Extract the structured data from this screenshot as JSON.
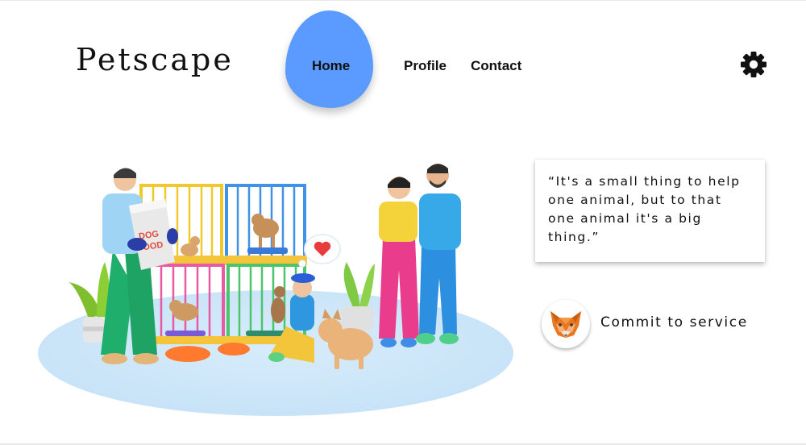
{
  "brand": {
    "name": "Petscape"
  },
  "nav": {
    "items": [
      {
        "label": "Home",
        "active": true
      },
      {
        "label": "Profile",
        "active": false
      },
      {
        "label": "Contact",
        "active": false
      }
    ],
    "active_color": "#5b9bff"
  },
  "settings": {
    "icon": "gear-icon"
  },
  "hero": {
    "illustration": {
      "bag_label_line1": "DOG",
      "bag_label_line2": "FOOD"
    }
  },
  "quote": {
    "lines": [
      "“It's a small thing to help",
      "one animal, but to that",
      "one animal it's a big",
      "thing.”"
    ]
  },
  "cta": {
    "label": "Commit to service",
    "icon": "fox-icon"
  }
}
